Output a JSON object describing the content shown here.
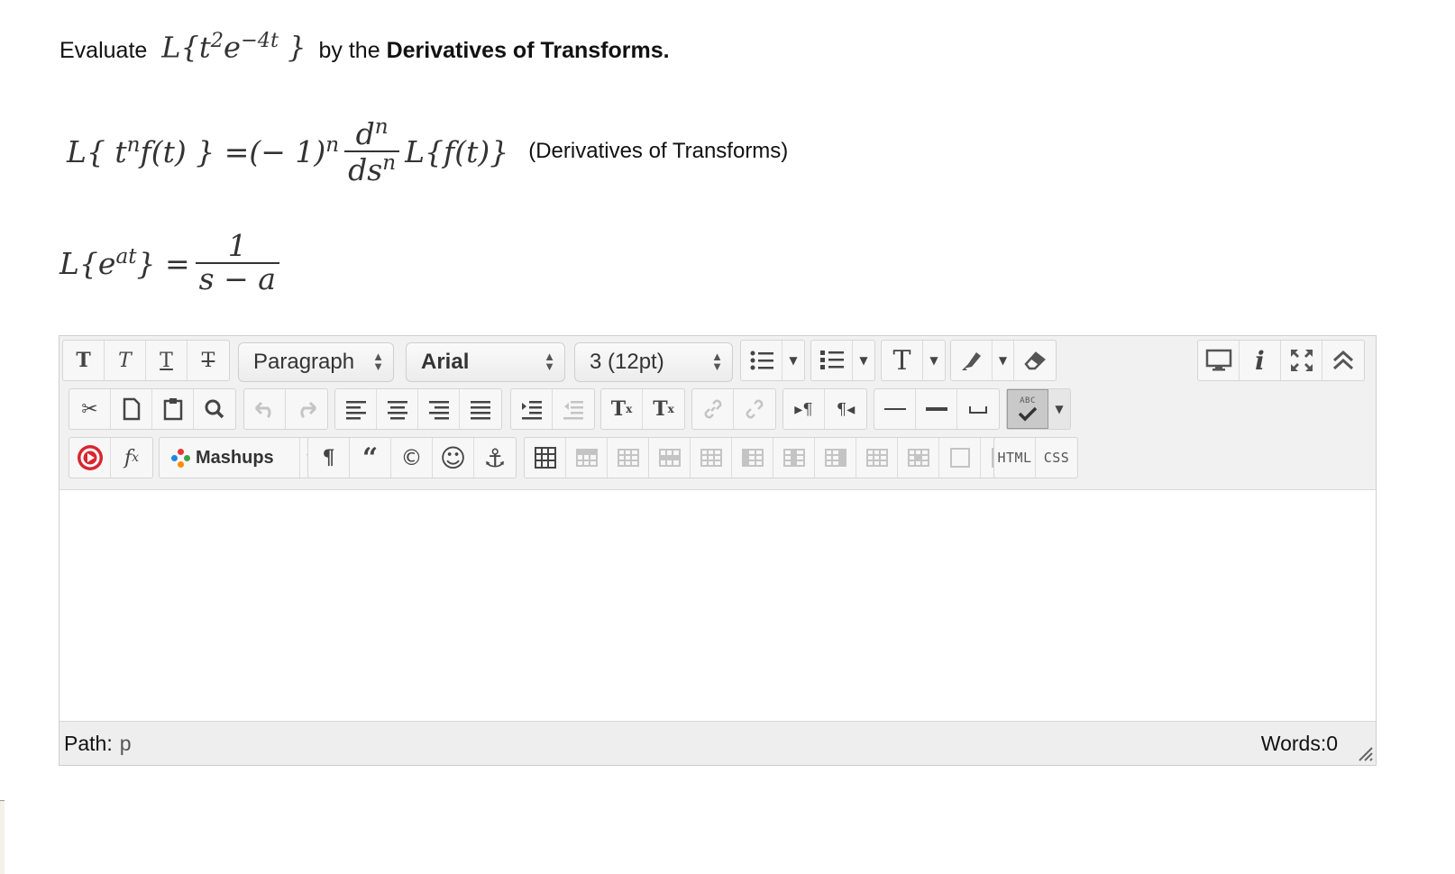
{
  "question": {
    "prefix": "Evaluate",
    "expr_L": "L{t",
    "expr_sup1": "2",
    "expr_e": "e",
    "expr_sup2": "−4t",
    "expr_close": "}",
    "mid": "by the",
    "bold": "Derivatives of Transforms."
  },
  "formula1": {
    "lhs": "L{ t",
    "lhs_sup": "n",
    "lhs_rest": "f(t) } =(− 1)",
    "pow_sup": "n",
    "num": "d",
    "num_sup": "n",
    "den": "ds",
    "den_sup": "n",
    "rhs": "L{f(t)}",
    "note": "(Derivatives of Transforms)"
  },
  "formula2": {
    "lhs": "L{e",
    "lhs_sup": "at",
    "lhs_rest": "} =",
    "num": "1",
    "den": "s − a"
  },
  "editor": {
    "format_select": "Paragraph",
    "font_select": "Arial",
    "size_select": "3 (12pt)",
    "mashups_label": "Mashups",
    "html_label": "HTML",
    "css_label": "CSS",
    "spell_label": "ABC",
    "path_label": "Path:",
    "path_value": "p",
    "words": "Words:0"
  }
}
